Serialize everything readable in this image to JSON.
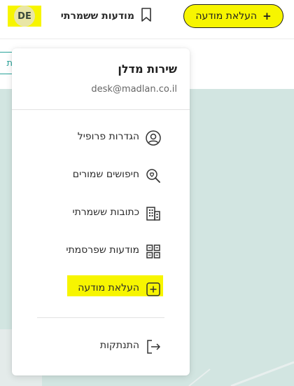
{
  "header": {
    "upload_button_label": "העלאת מודעה",
    "upload_button_icon": "+",
    "saved_ads_label": "מודעות ששמרתי",
    "avatar_initials": "DE"
  },
  "subbar": {
    "left_chip_text": "ת"
  },
  "menu": {
    "user_name": "שירות מדלן",
    "user_email": "desk@madlan.co.il",
    "items": [
      {
        "label": "הגדרות פרופיל",
        "icon": "user-circle-icon"
      },
      {
        "label": "חיפושים שמורים",
        "icon": "saved-search-icon"
      },
      {
        "label": "כתובות ששמרתי",
        "icon": "building-icon"
      },
      {
        "label": "מודעות שפרסמתי",
        "icon": "grid-icon"
      },
      {
        "label": "העלאת מודעה",
        "icon": "plus-square-icon"
      }
    ],
    "logout_label": "התנתקות"
  },
  "colors": {
    "highlight": "#f7f500",
    "map": "#d2e5e1",
    "teal": "#29a39a",
    "text": "#1f1f1f"
  }
}
